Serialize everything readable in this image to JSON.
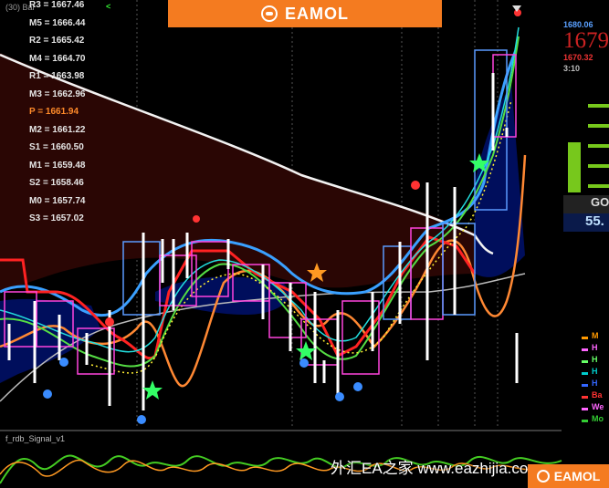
{
  "window": {
    "title_left": "(30) Bar",
    "arrow_label": "<"
  },
  "brand": {
    "name": "EAMOL",
    "name_bottom": "EAMOL"
  },
  "watermark": "外汇EA之家 www.eazhijia.com",
  "indicator": {
    "title": "f_rdb_Signal_v1"
  },
  "pivots": [
    {
      "label": "R3 = 1667.46",
      "type": "normal"
    },
    {
      "label": "M5 = 1666.44",
      "type": "normal"
    },
    {
      "label": "R2 = 1665.42",
      "type": "normal"
    },
    {
      "label": "M4 = 1664.70",
      "type": "normal"
    },
    {
      "label": "R1 = 1663.98",
      "type": "normal"
    },
    {
      "label": "M3 = 1662.96",
      "type": "normal"
    },
    {
      "label": "P   = 1661.94",
      "type": "pivot"
    },
    {
      "label": "M2 = 1661.22",
      "type": "normal"
    },
    {
      "label": "S1 = 1660.50",
      "type": "normal"
    },
    {
      "label": "M1 = 1659.48",
      "type": "normal"
    },
    {
      "label": "S2 = 1658.46",
      "type": "normal"
    },
    {
      "label": "M0 = 1657.74",
      "type": "normal"
    },
    {
      "label": "S3 = 1657.02",
      "type": "normal"
    }
  ],
  "right_panel": {
    "price_top": "1680.06",
    "price_big": "1679",
    "price_low": "1670.32",
    "timer": "3:10",
    "signal_label": "GO",
    "signal_value": "55."
  },
  "legend_items": [
    {
      "label": "M",
      "color": "#ff9900"
    },
    {
      "label": "H",
      "color": "#ff66ff"
    },
    {
      "label": "H",
      "color": "#66ff66"
    },
    {
      "label": "H",
      "color": "#00cccc"
    },
    {
      "label": "H",
      "color": "#3366ff"
    },
    {
      "label": "Ba",
      "color": "#ff3333"
    },
    {
      "label": "We",
      "color": "#ff66ff"
    },
    {
      "label": "Mo",
      "color": "#33cc33"
    }
  ],
  "colors": {
    "background": "#000000",
    "bear_cloud": "#2a0604",
    "bull_cloud": "#000e5c",
    "accent": "#f47b20"
  }
}
